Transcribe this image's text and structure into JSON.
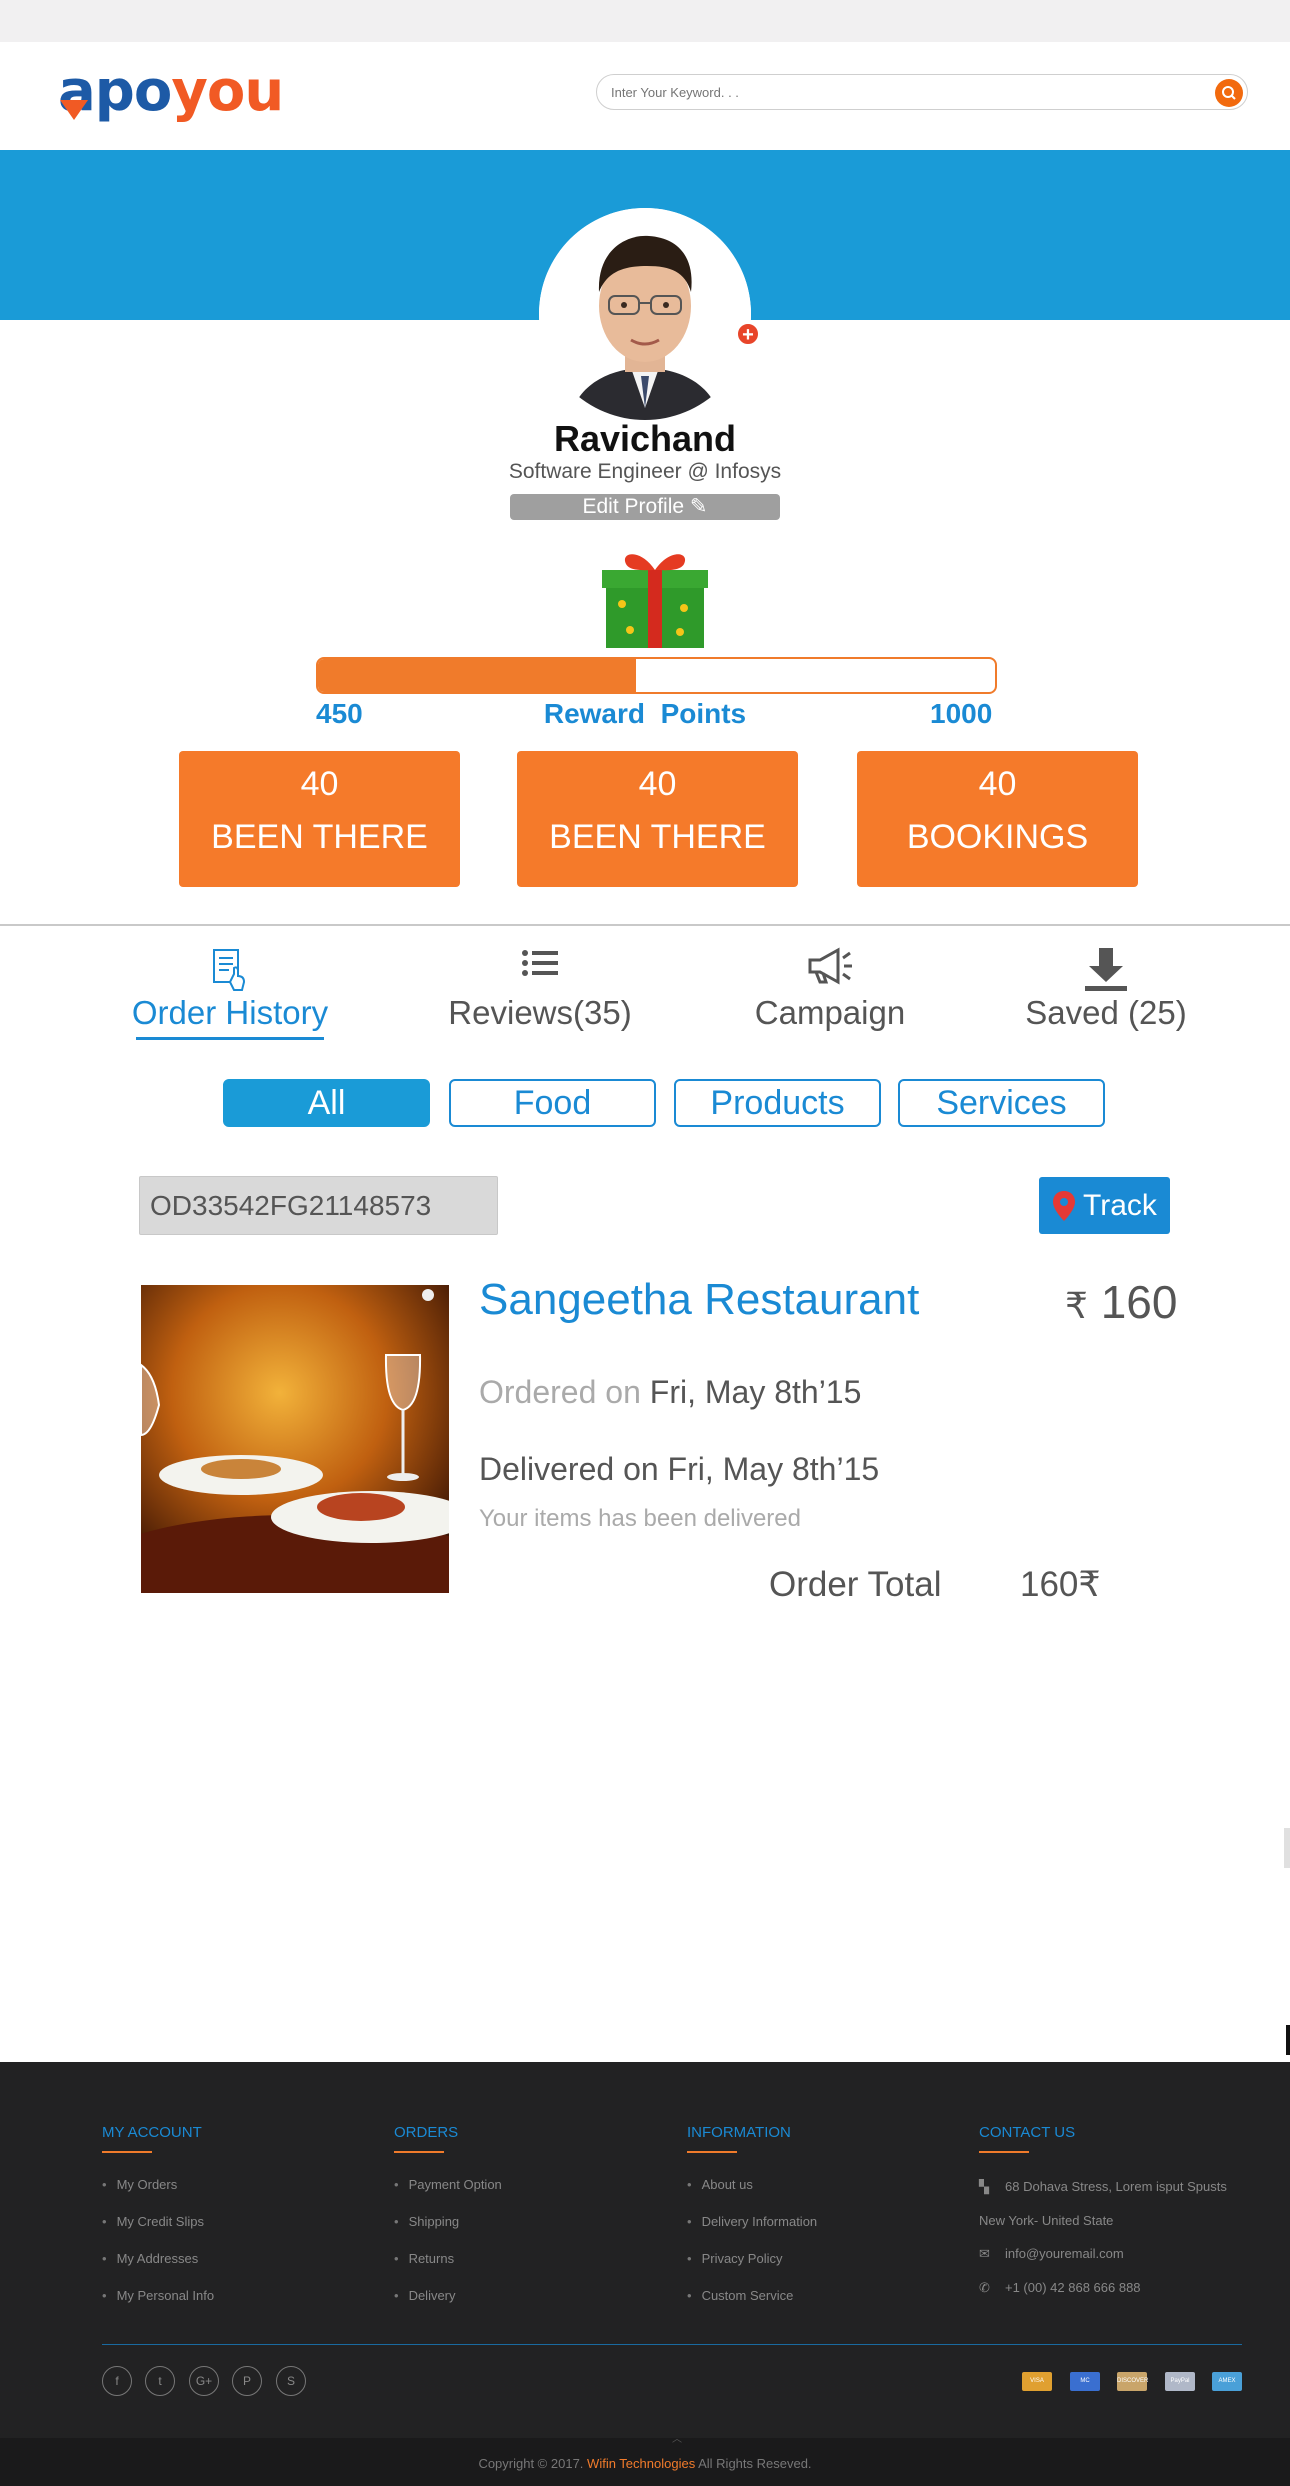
{
  "brand": {
    "logo_part1": "apo",
    "logo_part2": "you"
  },
  "search": {
    "placeholder": "Inter Your Keyword. . ."
  },
  "profile": {
    "name": "Ravichand",
    "title": "Software Engineer @ Infosys",
    "edit_label": "Edit Profile"
  },
  "reward": {
    "min": "450",
    "label": "Reward  Points",
    "max": "1000",
    "progress": 0.47
  },
  "stats": [
    {
      "value": "40",
      "label": "BEEN THERE"
    },
    {
      "value": "40",
      "label": "BEEN THERE"
    },
    {
      "value": "40",
      "label": "BOOKINGS"
    }
  ],
  "tabs": [
    {
      "label": "Order History",
      "icon": "receipt-hand-icon",
      "active": true
    },
    {
      "label": "Reviews(35)",
      "icon": "list-icon"
    },
    {
      "label": "Campaign",
      "icon": "megaphone-icon"
    },
    {
      "label": "Saved (25)",
      "icon": "download-icon"
    }
  ],
  "filters": [
    {
      "label": "All",
      "active": true
    },
    {
      "label": "Food"
    },
    {
      "label": "Products"
    },
    {
      "label": "Services"
    }
  ],
  "order": {
    "id": "OD33542FG21148573",
    "track_label": "Track",
    "restaurant": "Sangeetha Restaurant",
    "price_symbol": "₹",
    "price": "160",
    "ordered_prefix": "Ordered on",
    "ordered_date": "Fri, May 8th’15",
    "delivered": "Delivered on Fri, May 8th’15",
    "note": "Your items has been delivered",
    "total_label": "Order Total",
    "total_value": "160₹"
  },
  "footer": {
    "my_account": {
      "title": "MY ACCOUNT",
      "items": [
        "My Orders",
        "My Credit Slips",
        "My Addresses",
        "My Personal Info"
      ]
    },
    "orders": {
      "title": "ORDERS",
      "items": [
        "Payment Option",
        "Shipping",
        "Returns",
        "Delivery"
      ]
    },
    "information": {
      "title": "INFORMATION",
      "items": [
        "About us",
        "Delivery Information",
        "Privacy Policy",
        "Custom Service"
      ]
    },
    "contact": {
      "title": "CONTACT US",
      "address1": "68 Dohava Stress, Lorem isput Spusts",
      "address2": "New York- United State",
      "email": "info@youremail.com",
      "phone": "+1 (00) 42 868 666 888"
    },
    "social": [
      "f",
      "t",
      "G+",
      "P",
      "S"
    ],
    "payments": [
      {
        "name": "VISA",
        "color": "#e0a030"
      },
      {
        "name": "MC",
        "color": "#3a6fd0"
      },
      {
        "name": "DISCOVER",
        "color": "#c9a56a"
      },
      {
        "name": "PayPal",
        "color": "#b0b8c8"
      },
      {
        "name": "AMEX",
        "color": "#4aa0d8"
      }
    ],
    "copyright_prefix": "Copyright © 2017.",
    "company": "Wifin Technologies",
    "copyright_suffix": "All Rights Reseved."
  }
}
